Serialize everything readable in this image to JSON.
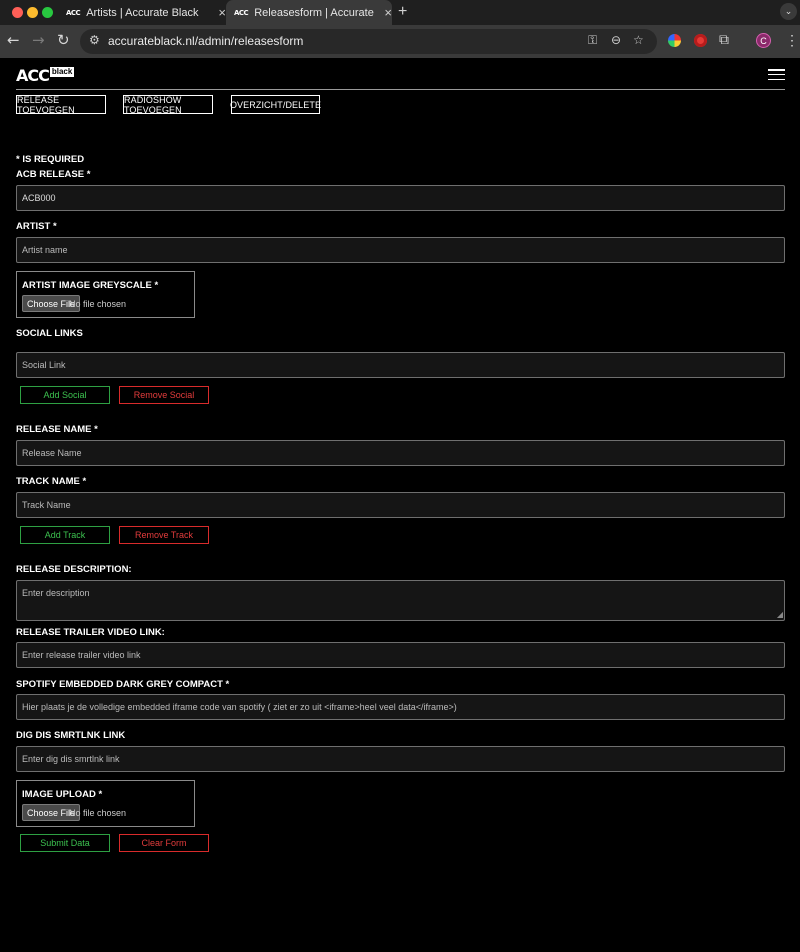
{
  "browser": {
    "tabs": [
      {
        "favicon": "ACC",
        "title": "Artists | Accurate Black",
        "close": "×"
      },
      {
        "favicon": "ACC",
        "title": "Releasesform | Accurate Black",
        "close": "×"
      }
    ],
    "new_tab": "+",
    "url": "accurateblack.nl/admin/releasesform",
    "profile_initial": "C"
  },
  "site": {
    "logo_main": "ACC",
    "logo_sub": "black",
    "nav_buttons": [
      "RELEASE TOEVOEGEN",
      "RADIOSHOW TOEVOEGEN",
      "OVERZICHT/DELETE"
    ]
  },
  "form": {
    "required_note": "* IS REQUIRED",
    "acb_release": {
      "label": "ACB RELEASE *",
      "value": "ACB000"
    },
    "artist": {
      "label": "ARTIST *",
      "placeholder": "Artist name"
    },
    "artist_image": {
      "label": "ARTIST IMAGE GREYSCALE *",
      "button": "Choose File",
      "status": "No file chosen"
    },
    "social": {
      "label": "SOCIAL LINKS",
      "placeholder": "Social Link",
      "add": "Add Social",
      "remove": "Remove Social"
    },
    "release_name": {
      "label": "RELEASE NAME *",
      "placeholder": "Release Name"
    },
    "track_name": {
      "label": "TRACK NAME *",
      "placeholder": "Track Name",
      "add": "Add Track",
      "remove": "Remove Track"
    },
    "description": {
      "label": "RELEASE DESCRIPTION:",
      "placeholder": "Enter description"
    },
    "trailer": {
      "label": "RELEASE TRAILER VIDEO LINK:",
      "placeholder": "Enter release trailer video link"
    },
    "spotify": {
      "label": "SPOTIFY EMBEDDED DARK GREY COMPACT *",
      "placeholder": "Hier plaats je de volledige embedded iframe code van spotify ( ziet er zo uit <iframe>heel veel data</iframe>)"
    },
    "smrtlnk": {
      "label": "DIG DIS SMRTLNK LINK",
      "placeholder": "Enter dig dis smrtlnk link"
    },
    "image_upload": {
      "label": "IMAGE UPLOAD *",
      "button": "Choose File",
      "status": "No file chosen"
    },
    "submit": "Submit Data",
    "clear": "Clear Form"
  }
}
